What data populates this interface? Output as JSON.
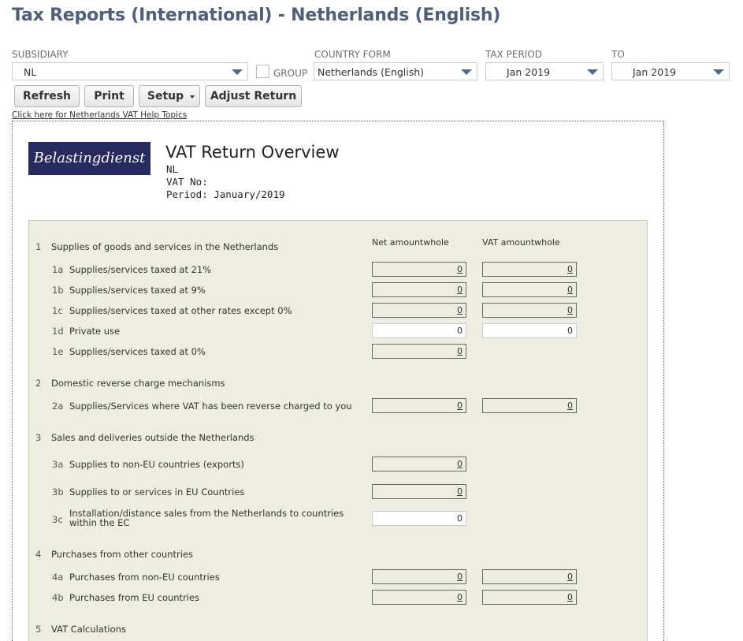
{
  "title": "Tax Reports (International) - Netherlands (English)",
  "filters": {
    "subsidiary_label": "SUBSIDIARY",
    "subsidiary_value": "NL",
    "group_label": "GROUP",
    "country_form_label": "COUNTRY FORM",
    "country_form_value": "Netherlands (English)",
    "tax_period_label": "TAX PERIOD",
    "tax_period_value": "Jan 2019",
    "to_label": "TO",
    "to_value": "Jan 2019"
  },
  "buttons": {
    "refresh": "Refresh",
    "print": "Print",
    "setup": "Setup",
    "adjust": "Adjust Return"
  },
  "help_link": "Click here for Netherlands VAT Help Topics",
  "report": {
    "logo_text": "Belastingdienst",
    "heading": "VAT Return Overview",
    "entity": "NL",
    "vat_no": "VAT No:",
    "period": "Period: January/2019",
    "col_net": "Net amountwhole",
    "col_vat": "VAT amountwhole",
    "sections": {
      "s1": {
        "num": "1",
        "title": "Supplies of goods and services in the Netherlands"
      },
      "s2": {
        "num": "2",
        "title": "Domestic reverse charge mechanisms"
      },
      "s3": {
        "num": "3",
        "title": "Sales and deliveries outside the Netherlands"
      },
      "s4": {
        "num": "4",
        "title": "Purchases from other countries"
      },
      "s5": {
        "num": "5",
        "title": "VAT Calculations"
      }
    },
    "lines": {
      "l1a": {
        "code": "1a",
        "label": "Supplies/services taxed at 21%",
        "net": "0",
        "vat": "0"
      },
      "l1b": {
        "code": "1b",
        "label": "Supplies/services taxed at 9%",
        "net": "0",
        "vat": "0"
      },
      "l1c": {
        "code": "1c",
        "label": "Supplies/services taxed at other rates except 0%",
        "net": "0",
        "vat": "0"
      },
      "l1d": {
        "code": "1d",
        "label": "Private use",
        "net": "0",
        "vat": "0"
      },
      "l1e": {
        "code": "1e",
        "label": "Supplies/services taxed at 0%",
        "net": "0"
      },
      "l2a": {
        "code": "2a",
        "label": "Supplies/Services where VAT has been reverse charged to you",
        "net": "0",
        "vat": "0"
      },
      "l3a": {
        "code": "3a",
        "label": "Supplies to non-EU countries (exports)",
        "net": "0"
      },
      "l3b": {
        "code": "3b",
        "label": "Supplies to or services in EU Countries",
        "net": "0"
      },
      "l3c": {
        "code": "3c",
        "label": "Installation/distance sales from the Netherlands to countries within the EC",
        "net": "0"
      },
      "l4a": {
        "code": "4a",
        "label": "Purchases from non-EU countries",
        "net": "0",
        "vat": "0"
      },
      "l4b": {
        "code": "4b",
        "label": "Purchases from EU countries",
        "net": "0",
        "vat": "0"
      }
    }
  }
}
